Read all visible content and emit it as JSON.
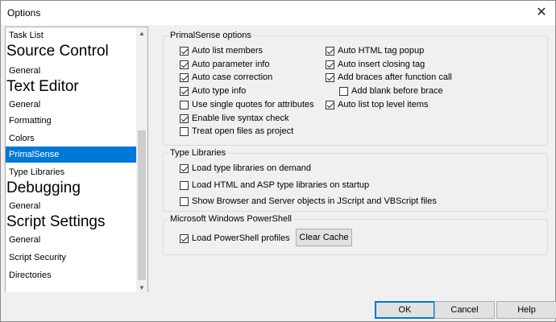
{
  "window": {
    "title": "Options",
    "close_glyph": "✕"
  },
  "sidebar": {
    "rows": [
      {
        "kind": "item",
        "label": "Task List"
      },
      {
        "kind": "cat",
        "label": "Source Control"
      },
      {
        "kind": "item",
        "label": "General"
      },
      {
        "kind": "cat",
        "label": "Text Editor"
      },
      {
        "kind": "item",
        "label": "General"
      },
      {
        "kind": "item",
        "label": "Formatting"
      },
      {
        "kind": "item",
        "label": "Colors"
      },
      {
        "kind": "item",
        "label": "PrimalSense",
        "selected": true
      },
      {
        "kind": "item",
        "label": "Type Libraries"
      },
      {
        "kind": "cat",
        "label": "Debugging"
      },
      {
        "kind": "item",
        "label": "General"
      },
      {
        "kind": "cat",
        "label": "Script Settings"
      },
      {
        "kind": "item",
        "label": "General"
      },
      {
        "kind": "item",
        "label": "Script Security"
      },
      {
        "kind": "item",
        "label": "Directories"
      }
    ],
    "scroll_up": "▲",
    "scroll_down": "▼"
  },
  "primalsense": {
    "legend": "PrimalSense options",
    "left": [
      {
        "label": "Auto list members",
        "checked": true
      },
      {
        "label": "Auto parameter info",
        "checked": true
      },
      {
        "label": "Auto case correction",
        "checked": true
      },
      {
        "label": "Auto type info",
        "checked": true
      },
      {
        "label": "Use single quotes for attributes",
        "checked": false
      },
      {
        "label": "Enable live syntax check",
        "checked": true
      },
      {
        "label": "Treat open files as project",
        "checked": false
      }
    ],
    "right": [
      {
        "label": "Auto HTML tag popup",
        "checked": true
      },
      {
        "label": "Auto insert closing tag",
        "checked": true
      },
      {
        "label": "Add braces after function call",
        "checked": true
      },
      {
        "label": "Add blank before brace",
        "checked": false,
        "indent": true
      },
      {
        "label": "Auto list top level items",
        "checked": true
      }
    ]
  },
  "type_libraries": {
    "legend": "Type Libraries",
    "options": [
      {
        "label": "Load type libraries on demand",
        "checked": true
      },
      {
        "label": "Load HTML and ASP type libraries on startup",
        "checked": false
      },
      {
        "label": "Show Browser and Server objects in JScript and VBScript files",
        "checked": false
      }
    ]
  },
  "powershell": {
    "legend": "Microsoft Windows PowerShell",
    "load_profiles": {
      "label": "Load PowerShell profiles",
      "checked": true
    },
    "clear_cache_label": "Clear Cache"
  },
  "footer": {
    "ok_label": "OK",
    "cancel_label": "Cancel",
    "help_label": "Help"
  }
}
